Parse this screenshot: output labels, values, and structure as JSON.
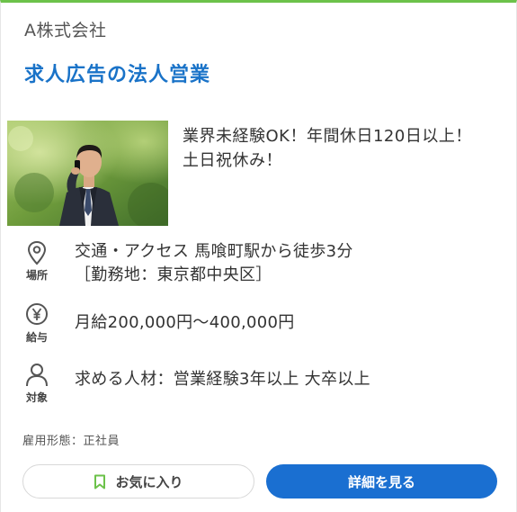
{
  "company": "A株式会社",
  "job_title": "求人広告の法人営業",
  "photo": {
    "icon": "businessman-on-phone-photo"
  },
  "catch_copy": {
    "line1": "業界未経験OK！年間休日120日以上！",
    "line2": "土日祝休み！"
  },
  "location": {
    "icon": "map-pin-icon",
    "label": "場所",
    "line1": "交通・アクセス 馬喰町駅から徒歩3分",
    "line2": "［勤務地：東京都中央区］"
  },
  "salary": {
    "icon": "yen-icon",
    "label": "給与",
    "text": "月給200,000円～400,000円"
  },
  "target": {
    "icon": "person-icon",
    "label": "対象",
    "text": "求める人材：営業経験3年以上 大卒以上"
  },
  "employment_type": "雇用形態：正社員",
  "buttons": {
    "favorite": "お気に入り",
    "detail": "詳細を見る"
  },
  "colors": {
    "accent_top": "#6cc24a",
    "title_blue": "#1a73c8",
    "button_blue": "#1a6fd1",
    "bookmark_green": "#6cc24a"
  }
}
